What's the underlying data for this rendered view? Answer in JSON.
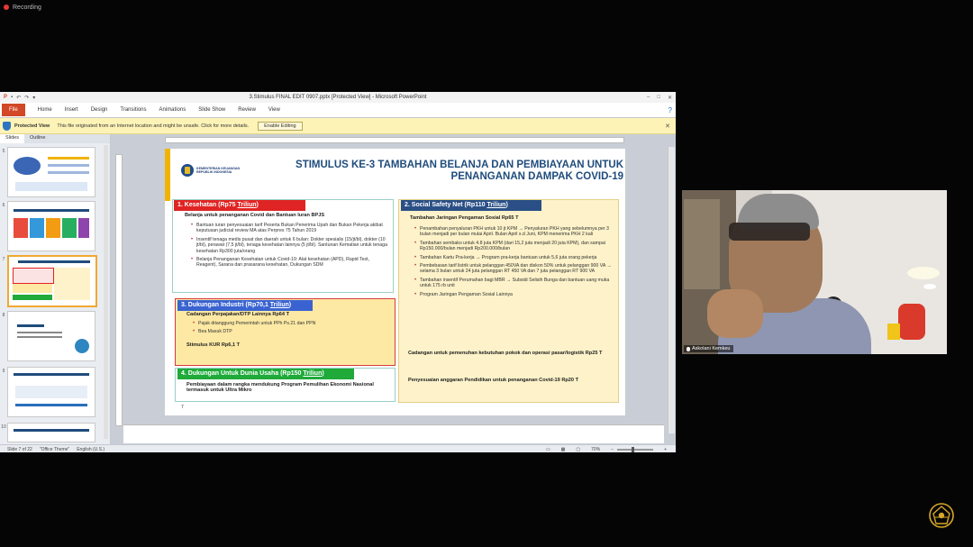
{
  "recording": {
    "label": "Recording"
  },
  "window": {
    "title": "3.Stimulus FINAL EDIT 0907.pptx [Protected View] - Microsoft PowerPoint",
    "controls": [
      "–",
      "□",
      "✕"
    ]
  },
  "ribbon": {
    "file_label": "File",
    "tabs": [
      "Home",
      "Insert",
      "Design",
      "Transitions",
      "Animations",
      "Slide Show",
      "Review",
      "View"
    ],
    "help_icon": "?"
  },
  "protected_bar": {
    "title": "Protected View",
    "message": "This file originated from an Internet location and might be unsafe. Click for more details.",
    "button": "Enable Editing",
    "close": "✕"
  },
  "panel": {
    "tabs": [
      "Slides",
      "Outline"
    ],
    "thumbnail_numbers": [
      "5",
      "6",
      "7",
      "8",
      "9",
      "10"
    ]
  },
  "statusbar": {
    "slide": "Slide 7 of 22",
    "theme": "\"Office Theme\"",
    "language": "English (U.S.)",
    "zoom": "70%"
  },
  "slide": {
    "logo_text": [
      "KEMENTERIAN KEUANGAN",
      "REPUBLIK INDONESIA"
    ],
    "title_line1": "STIMULUS KE-3 TAMBAHAN BELANJA DAN PEMBIAYAAN UNTUK",
    "title_line2": "PENANGANAN DAMPAK COVID-19",
    "sec1": {
      "title_prefix": "1. Kesehatan (Rp75 ",
      "title_ul": "Triliun",
      "title_suffix": ")",
      "subtitle": "Belanja untuk penanganan Covid dan Bantuan Iuran BPJS",
      "bullets": [
        "Bantuan iuran penyesuaian tarif Peserta Bukan Penerima Upah dan Bukan Pekerja akibat keputusan judicial review MA atas Perpres 75 Tahun 2019",
        "Insentif tenaga medis pusat dan daerah untuk 6 bulan: Dokter spesialis (15/jt/bl), dokter (10 jt/bl), perawat (7,5 jt/bl), tenaga kesehatan lainnya (5 jt/bl). Santunan Kematian untuk tenaga kesehatan Rp300 juta/orang",
        "Belanja Penanganan Kesehatan untuk Covid-19: Alat kesehatan (APD), Rapid Test, Reagent), Sarana dan prasarana kesehatan, Dukungan SDM"
      ]
    },
    "sec2": {
      "title_prefix": "2. Social Safety Net (Rp110 ",
      "title_ul": "Triliun",
      "title_suffix": ")",
      "subtitle": "Tambahan Jaringan Pengaman Sosial Rp65 T",
      "bullets": [
        "Penambahan penyaluran PKH untuk 10 jt KPM → Penyaluran PKH yang sebelumnya per 3 bulan menjadi per bulan mulai April. Bulan April s.d Juni, KPM menerima PKH 2 kali",
        "Tambahan sembako untuk 4.8 juta KPM (dari 15,2 juta menjadi 20 juta KPM), dan sampai Rp150.000/bulan menjadi Rp200.000/bulan",
        "Tambahan Kartu Pra-kerja → Program pra-kerja bantuan untuk 5,6 juta orang pekerja",
        "Pembebasan tarif listrik untuk pelanggan 450VA dan diskon 50% untuk pelanggan 900 VA → selama 3 bulan untuk 24 juta pelanggan RT 450 VA dan 7 juta pelanggan RT 900 VA",
        "Tambahan insentif Perumahan bagi MBR → Subsidi Selisih Bunga dan bantuan uang muka untuk 175 rb unit",
        "Program Jaringan Pengaman Sosial Lainnya"
      ],
      "para1": "Cadangan untuk pemenuhan kebutuhan pokok dan operasi pasar/logistik Rp25 T",
      "para2": "Penyesuaian anggaran Pendidikan untuk penanganan Covid-19 Rp20 T"
    },
    "sec3": {
      "title_prefix": "3. Dukungan Industri (Rp70,1 ",
      "title_ul": "Triliun",
      "title_suffix": ")",
      "subtitle": "Cadangan Perpajakan/DTP Lainnya Rp64 T",
      "bullets": [
        "Pajak ditanggung Pemerintah untuk PPh Ps.21 dan PPN",
        "Bea Masuk DTP"
      ],
      "stimulus": "Stimulus KUR Rp6,1 T"
    },
    "sec4": {
      "title_prefix": "4. Dukungan Untuk Dunia Usaha (Rp150 ",
      "title_ul": "Triliun",
      "title_suffix": ")",
      "body": "Pembiayaan dalam rangka mendukung Program Pemulihan Ekonomi Nasional termasuk untuk Ultra Mikro"
    },
    "page_num": "7"
  },
  "video": {
    "participant_name": "Askolani Kemkeu"
  },
  "colors": {
    "file_tab": "#d24726",
    "slide_title": "#1f4c7c",
    "sec1_head": "#e02424",
    "sec2_head": "#2a4f86",
    "sec3_head": "#3a63d1",
    "sec4_head": "#1faa3a",
    "sec2_bg": "#fdf2c9",
    "sec3_bg": "#fde9a4"
  }
}
